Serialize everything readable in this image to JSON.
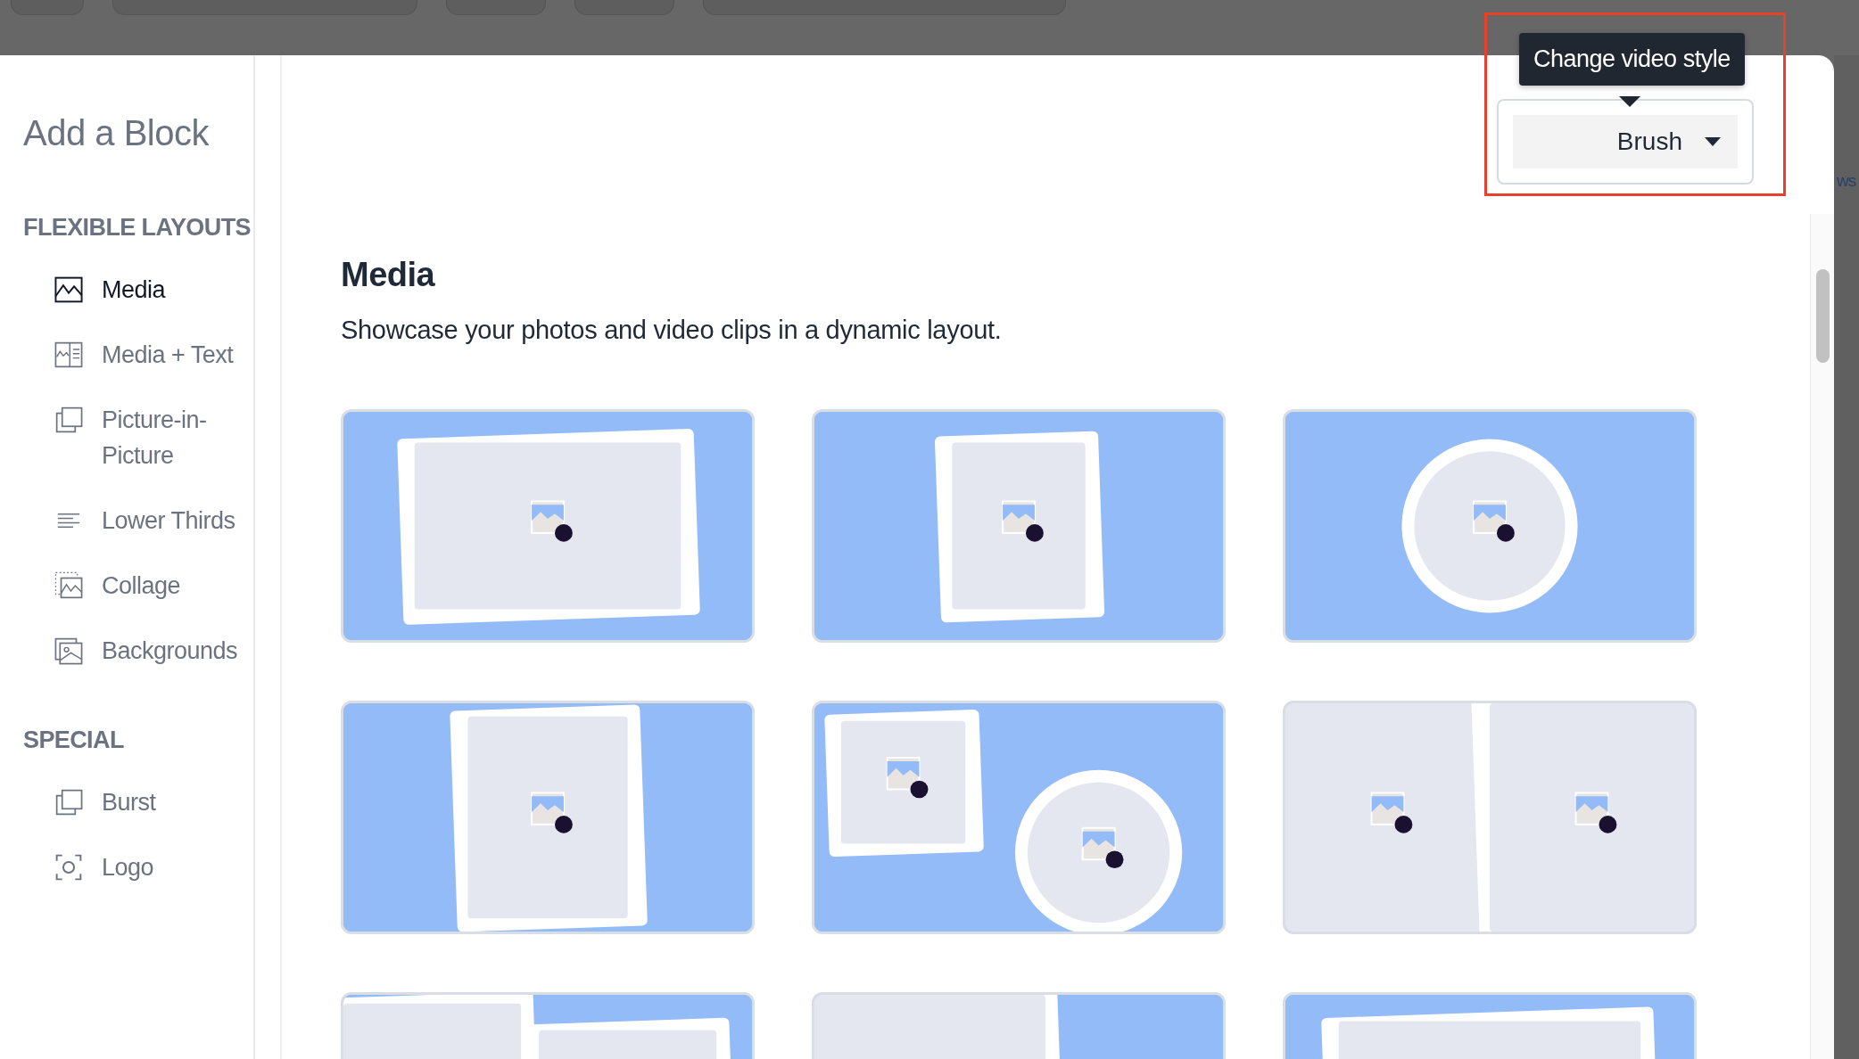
{
  "sidebar": {
    "title": "Add a Block",
    "sections": [
      {
        "heading": "FLEXIBLE LAYOUTS",
        "items": [
          {
            "label": "Media",
            "kind": "media",
            "selected": true
          },
          {
            "label": "Media + Text",
            "kind": "mediatext",
            "selected": false
          },
          {
            "label": "Picture-in-Picture",
            "kind": "pip",
            "selected": false
          },
          {
            "label": "Lower Thirds",
            "kind": "lines",
            "selected": false
          },
          {
            "label": "Collage",
            "kind": "collage",
            "selected": false
          },
          {
            "label": "Backgrounds",
            "kind": "backgrounds",
            "selected": false
          }
        ]
      },
      {
        "heading": "SPECIAL",
        "items": [
          {
            "label": "Burst",
            "kind": "pip",
            "selected": false
          },
          {
            "label": "Logo",
            "kind": "logo",
            "selected": false
          }
        ]
      }
    ]
  },
  "style_dropdown": {
    "tooltip": "Change video style",
    "value": "Brush"
  },
  "content": {
    "title": "Media",
    "description": "Showcase your photos and video clips in a dynamic layout."
  },
  "background_text": "ws"
}
